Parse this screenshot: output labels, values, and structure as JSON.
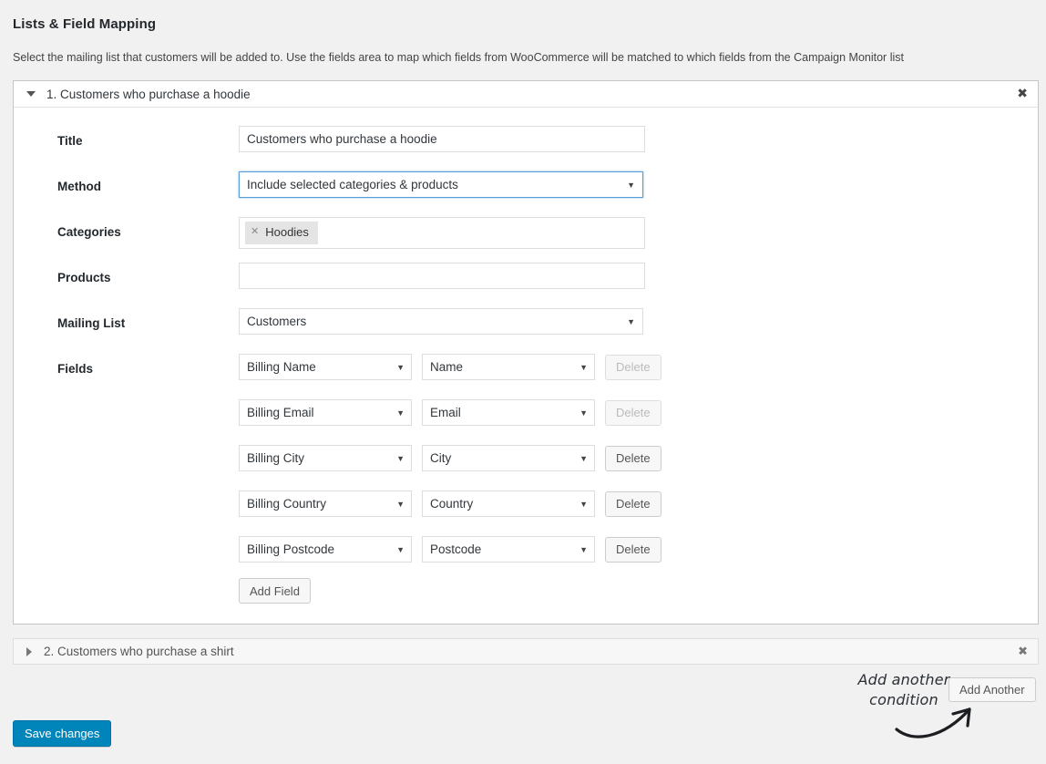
{
  "section": {
    "title": "Lists & Field Mapping",
    "description": "Select the mailing list that customers will be added to. Use the fields area to map which fields from WooCommerce will be matched to which fields from the Campaign Monitor list"
  },
  "panel1": {
    "header_title": "1. Customers who purchase a hoodie",
    "close_icon": "close-icon",
    "close_glyph": "✖",
    "toggle_icon": "caret-down-icon",
    "labels": {
      "title": "Title",
      "method": "Method",
      "categories": "Categories",
      "products": "Products",
      "mailing_list": "Mailing List",
      "fields": "Fields"
    },
    "title_value": "Customers who purchase a hoodie",
    "title_placeholder": "",
    "method_value": "Include selected categories & products",
    "categories_tags": [
      {
        "label": "Hoodies",
        "remove_glyph": "✕"
      }
    ],
    "products_value": "",
    "products_placeholder": "",
    "mailing_list_value": "Customers",
    "select_arrow_glyph": "▼",
    "fields": [
      {
        "source": "Billing Name",
        "target": "Name",
        "delete_label": "Delete",
        "delete_disabled": true
      },
      {
        "source": "Billing Email",
        "target": "Email",
        "delete_label": "Delete",
        "delete_disabled": true
      },
      {
        "source": "Billing City",
        "target": "City",
        "delete_label": "Delete",
        "delete_disabled": false
      },
      {
        "source": "Billing Country",
        "target": "Country",
        "delete_label": "Delete",
        "delete_disabled": false
      },
      {
        "source": "Billing Postcode",
        "target": "Postcode",
        "delete_label": "Delete",
        "delete_disabled": false
      }
    ],
    "add_field_label": "Add Field"
  },
  "panel2": {
    "header_title": "2. Customers who purchase a shirt",
    "close_glyph": "✖",
    "toggle_icon": "caret-right-icon"
  },
  "footer": {
    "add_another_label": "Add Another",
    "annotation_line1": "Add another",
    "annotation_line2": "condition",
    "annotation_arrow_icon": "curved-arrow-icon",
    "save_label": "Save changes"
  },
  "colors": {
    "page_background": "#f1f1f1",
    "panel_background": "#ffffff",
    "accent_primary": "#0085ba",
    "focus_border": "#5b9dd9",
    "tag_background": "#e4e4e4",
    "text": "#444444",
    "heading": "#23282d"
  }
}
